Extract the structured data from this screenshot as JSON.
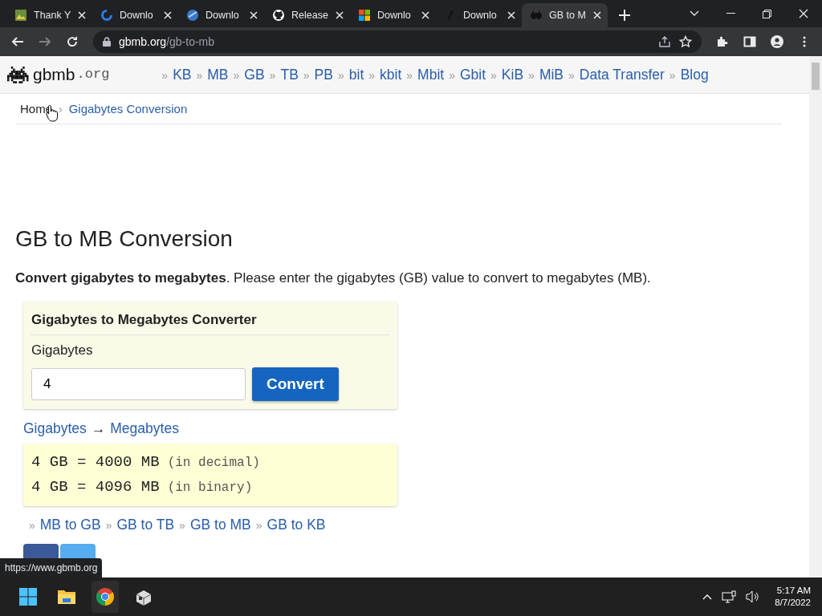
{
  "browser": {
    "tabs": [
      {
        "title": "Thank Y",
        "selected": false
      },
      {
        "title": "Downlo",
        "selected": false
      },
      {
        "title": "Downlo",
        "selected": false
      },
      {
        "title": "Release",
        "selected": false
      },
      {
        "title": "Downlo",
        "selected": false
      },
      {
        "title": "Downlo",
        "selected": false
      },
      {
        "title": "GB to M",
        "selected": true
      }
    ],
    "address": {
      "domain": "gbmb.org",
      "path": "/gb-to-mb"
    },
    "status_url": "https://www.gbmb.org"
  },
  "site": {
    "logo": "gbmb",
    "logo_suffix": ".org",
    "nav_separator": "»",
    "nav": [
      "KB",
      "MB",
      "GB",
      "TB",
      "PB",
      "bit",
      "kbit",
      "Mbit",
      "Gbit",
      "KiB",
      "MiB",
      "Data Transfer",
      "Blog"
    ],
    "breadcrumb_separator": "›",
    "breadcrumbs": [
      "Home",
      "Gigabytes Conversion"
    ]
  },
  "heading": "GB to MB Conversion",
  "intro": "**Convert gigabytes to megabytes**. Please enter the gigabytes (GB) value to convert to megabytes (MB).",
  "converter": {
    "title": "Gigabytes to Megabytes Converter",
    "label": "Gigabytes",
    "value": "4",
    "button": "Convert"
  },
  "direction": {
    "from": "Gigabytes",
    "arrow": "→",
    "to": "Megabytes"
  },
  "results": [
    {
      "equation": "4 GB = 4000 MB",
      "note": "(in decimal)"
    },
    {
      "equation": "4 GB = 4096 MB",
      "note": "(in binary)"
    }
  ],
  "related_separator": "»",
  "related": [
    "MB to GB",
    "GB to TB",
    "GB to MB",
    "GB to KB"
  ],
  "taskbar": {
    "time": "5:17 AM",
    "date": "8/7/2022"
  }
}
